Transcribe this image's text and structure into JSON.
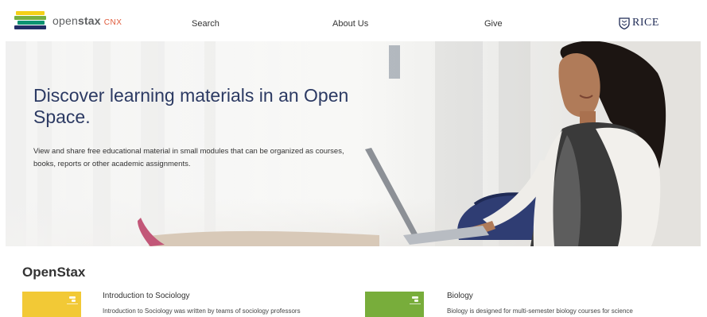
{
  "header": {
    "logo": {
      "brand_light": "open",
      "brand_bold": "stax",
      "product": "CNX"
    },
    "nav": {
      "search": "Search",
      "about": "About Us",
      "give": "Give"
    },
    "partner_logo": {
      "text": "RICE",
      "icon": "rice-shield-icon"
    }
  },
  "hero": {
    "title": "Discover learning materials in an Open Space.",
    "description": "View and share free educational material in small modules that can be organized as courses, books, reports or other academic assignments."
  },
  "featured": {
    "heading": "OpenStax",
    "books": [
      {
        "title": "Introduction to Sociology",
        "description": "Introduction to Sociology was written by teams of sociology professors",
        "cover_color": "#f2c936"
      },
      {
        "title": "Biology",
        "description": "Biology is designed for multi-semester biology courses for science",
        "cover_color": "#78ad3b"
      }
    ]
  },
  "colors": {
    "brand_navy": "#232e66",
    "hero_title": "#2c3a63",
    "cnx_accent": "#e05a3a"
  }
}
